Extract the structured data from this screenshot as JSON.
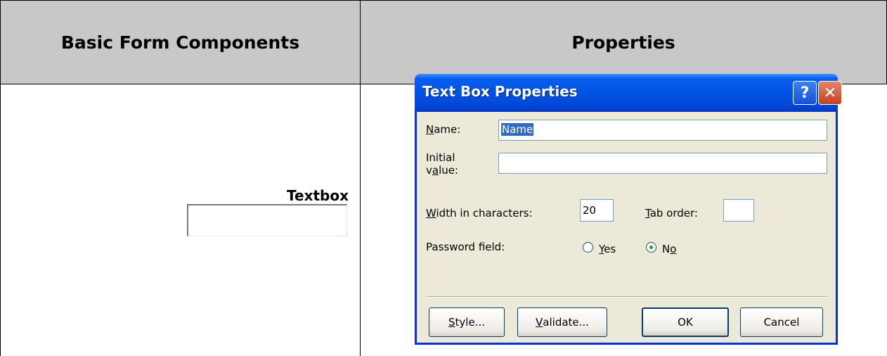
{
  "table": {
    "header_left": "Basic Form Components",
    "header_right": "Properties",
    "component_label": "Textbox"
  },
  "dialog": {
    "title": "Text Box Properties",
    "help_icon": "?",
    "close_icon": "✕",
    "name": {
      "mnemonic": "N",
      "rest": "ame:",
      "value": "Name"
    },
    "initial": {
      "line1": "Initial",
      "line2_pre": "v",
      "mnemonic": "a",
      "line2_post": "lue:",
      "value": ""
    },
    "width": {
      "mnemonic": "W",
      "rest": "idth in characters:",
      "value": "20"
    },
    "tab_order": {
      "mnemonic": "T",
      "rest": "ab order:",
      "value": ""
    },
    "password": {
      "label": "Password field:",
      "yes_mnemonic": "Y",
      "yes_rest": "es",
      "no_pre": "N",
      "no_mnemonic": "o",
      "selected": "No"
    },
    "buttons": {
      "style": {
        "mnemonic": "S",
        "rest": "tyle..."
      },
      "validate": {
        "mnemonic": "V",
        "rest": "alidate..."
      },
      "ok": "OK",
      "cancel": "Cancel"
    }
  },
  "colors": {
    "header_bg": "#c8c8c8",
    "titlebar": "#0054e3",
    "dialog_bg": "#ece9d8",
    "selection": "#316ac5"
  }
}
